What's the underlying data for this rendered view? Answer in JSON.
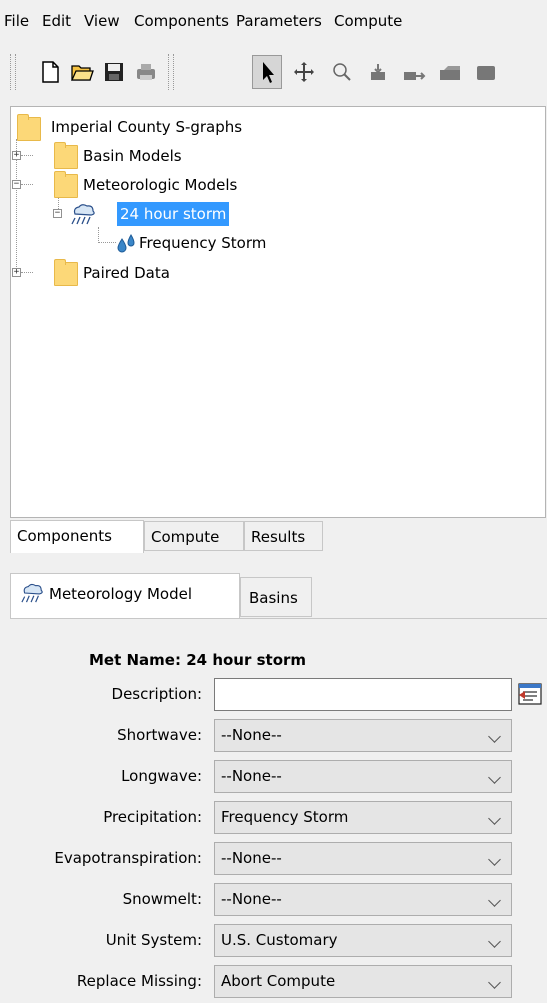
{
  "menu": [
    "File",
    "Edit",
    "View",
    "Components",
    "Parameters",
    "Compute"
  ],
  "toolbar": {
    "buttons": [
      "new-icon",
      "open-icon",
      "save-icon",
      "print-icon",
      "select-arrow-icon",
      "pan-icon",
      "zoom-icon",
      "add-subbasin-icon",
      "add-reach-icon",
      "add-reservoir-icon"
    ]
  },
  "tree": {
    "root": "Imperial County S-graphs",
    "basin": "Basin Models",
    "met": "Meteorologic Models",
    "storm": "24 hour storm",
    "freq": "Frequency Storm",
    "paired": "Paired Data"
  },
  "bottom_tabs": [
    "Components",
    "Compute",
    "Results"
  ],
  "detail_tabs": [
    "Meteorology Model",
    "Basins"
  ],
  "form": {
    "met_name_label": "Met Name:",
    "met_name_value": "24 hour storm",
    "description_label": "Description:",
    "description_value": "",
    "fields": [
      {
        "label": "Shortwave:",
        "value": "--None--"
      },
      {
        "label": "Longwave:",
        "value": "--None--"
      },
      {
        "label": "Precipitation:",
        "value": "Frequency Storm"
      },
      {
        "label": "Evapotranspiration:",
        "value": "--None--"
      },
      {
        "label": "Snowmelt:",
        "value": "--None--"
      },
      {
        "label": "Unit System:",
        "value": "U.S. Customary"
      },
      {
        "label": "Replace Missing:",
        "value": "Abort Compute"
      }
    ]
  },
  "colors": {
    "selection": "#3399ff",
    "folder": "#fcd878"
  }
}
